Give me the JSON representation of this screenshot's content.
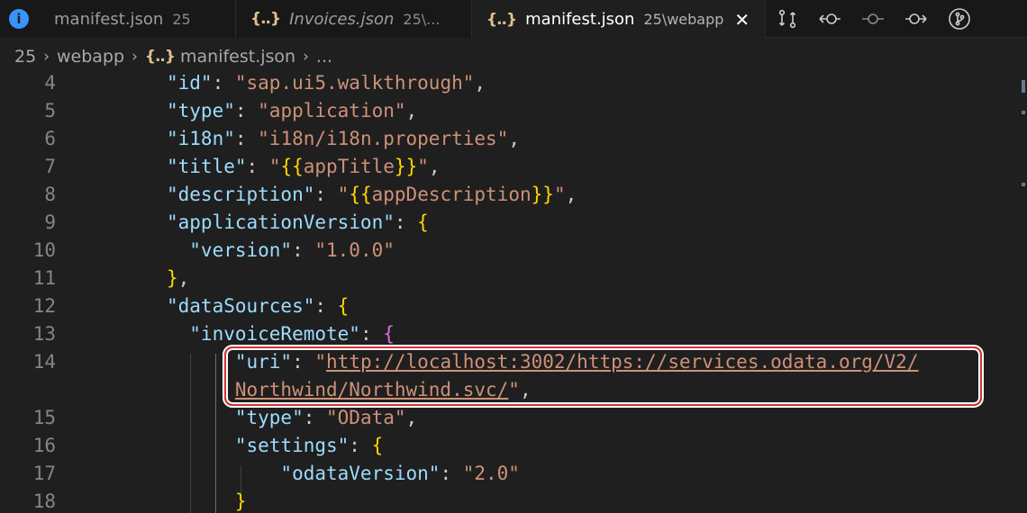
{
  "tabs": [
    {
      "name": "manifest.json",
      "description": "25",
      "active": false,
      "italic": false,
      "icon": "info-icon"
    },
    {
      "name": "Invoices.json",
      "description": "25\\...",
      "active": false,
      "italic": true,
      "icon": "json-icon"
    },
    {
      "name": "manifest.json",
      "description": "25\\webapp",
      "active": true,
      "italic": false,
      "icon": "json-icon"
    }
  ],
  "icons": {
    "json_glyph": "{..}",
    "info_glyph": "i",
    "close_glyph": "✕"
  },
  "actions": [
    "compare-changes-icon",
    "previous-change-icon",
    "timeline-icon",
    "next-change-icon",
    "git-graph-icon"
  ],
  "breadcrumb": {
    "segments": [
      "25",
      "webapp",
      "manifest.json",
      "..."
    ],
    "separator": "›"
  },
  "editor": {
    "lines": [
      {
        "number": "4",
        "tokens": [
          {
            "t": "\"id\"",
            "c": "key"
          },
          {
            "t": ": ",
            "c": "punct"
          },
          {
            "t": "\"sap.ui5.walkthrough\"",
            "c": "str"
          },
          {
            "t": ",",
            "c": "punct"
          }
        ]
      },
      {
        "number": "5",
        "tokens": [
          {
            "t": "\"type\"",
            "c": "key"
          },
          {
            "t": ": ",
            "c": "punct"
          },
          {
            "t": "\"application\"",
            "c": "str"
          },
          {
            "t": ",",
            "c": "punct"
          }
        ]
      },
      {
        "number": "6",
        "tokens": [
          {
            "t": "\"i18n\"",
            "c": "key"
          },
          {
            "t": ": ",
            "c": "punct"
          },
          {
            "t": "\"i18n/i18n.properties\"",
            "c": "str"
          },
          {
            "t": ",",
            "c": "punct"
          }
        ]
      },
      {
        "number": "7",
        "tokens": [
          {
            "t": "\"title\"",
            "c": "key"
          },
          {
            "t": ": ",
            "c": "punct"
          },
          {
            "t": "\"",
            "c": "str"
          },
          {
            "t": "{{",
            "c": "curly"
          },
          {
            "t": "appTitle",
            "c": "str"
          },
          {
            "t": "}}",
            "c": "curly"
          },
          {
            "t": "\"",
            "c": "str"
          },
          {
            "t": ",",
            "c": "punct"
          }
        ]
      },
      {
        "number": "8",
        "tokens": [
          {
            "t": "\"description\"",
            "c": "key"
          },
          {
            "t": ": ",
            "c": "punct"
          },
          {
            "t": "\"",
            "c": "str"
          },
          {
            "t": "{{",
            "c": "curly"
          },
          {
            "t": "appDescription",
            "c": "str"
          },
          {
            "t": "}}",
            "c": "curly"
          },
          {
            "t": "\"",
            "c": "str"
          },
          {
            "t": ",",
            "c": "punct"
          }
        ]
      },
      {
        "number": "9",
        "tokens": [
          {
            "t": "\"applicationVersion\"",
            "c": "key"
          },
          {
            "t": ": ",
            "c": "punct"
          },
          {
            "t": "{",
            "c": "curly"
          }
        ]
      },
      {
        "number": "10",
        "tokens": [
          {
            "t": "  \"version\"",
            "c": "key"
          },
          {
            "t": ": ",
            "c": "punct"
          },
          {
            "t": "\"1.0.0\"",
            "c": "str"
          }
        ]
      },
      {
        "number": "11",
        "tokens": [
          {
            "t": "}",
            "c": "curly"
          },
          {
            "t": ",",
            "c": "punct"
          }
        ]
      },
      {
        "number": "12",
        "tokens": [
          {
            "t": "\"dataSources\"",
            "c": "key"
          },
          {
            "t": ": ",
            "c": "punct"
          },
          {
            "t": "{",
            "c": "curly"
          }
        ]
      },
      {
        "number": "13",
        "tokens": [
          {
            "t": "  \"invoiceRemote\"",
            "c": "key"
          },
          {
            "t": ": ",
            "c": "punct"
          },
          {
            "t": "{",
            "c": "brace"
          }
        ]
      },
      {
        "number": "14",
        "tokens": [
          {
            "t": "      \"uri\"",
            "c": "key"
          },
          {
            "t": ": ",
            "c": "punct"
          },
          {
            "t": "\"",
            "c": "str"
          },
          {
            "t": "http://localhost:3002/https://services.odata.org/V2/",
            "c": "link"
          }
        ]
      },
      {
        "number": "",
        "tokens": [
          {
            "t": "      ",
            "c": "punct"
          },
          {
            "t": "Northwind/Northwind.svc/",
            "c": "link"
          },
          {
            "t": "\"",
            "c": "str"
          },
          {
            "t": ",",
            "c": "punct"
          }
        ]
      },
      {
        "number": "15",
        "tokens": [
          {
            "t": "      \"type\"",
            "c": "key"
          },
          {
            "t": ": ",
            "c": "punct"
          },
          {
            "t": "\"OData\"",
            "c": "str"
          },
          {
            "t": ",",
            "c": "punct"
          }
        ]
      },
      {
        "number": "16",
        "tokens": [
          {
            "t": "      \"settings\"",
            "c": "key"
          },
          {
            "t": ": ",
            "c": "punct"
          },
          {
            "t": "{",
            "c": "curly"
          }
        ]
      },
      {
        "number": "17",
        "tokens": [
          {
            "t": "          \"odataVersion\"",
            "c": "key"
          },
          {
            "t": ": ",
            "c": "punct"
          },
          {
            "t": "\"2.0\"",
            "c": "str"
          }
        ]
      },
      {
        "number": "18",
        "tokens": [
          {
            "t": "      }",
            "c": "curly"
          }
        ]
      }
    ]
  }
}
